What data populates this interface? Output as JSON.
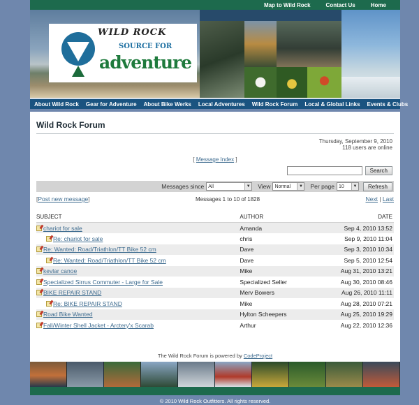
{
  "topnav": [
    "Map to Wild Rock",
    "Contact Us",
    "Home"
  ],
  "logo": {
    "name": "WILD ROCK",
    "tagline_top": "SOURCE FOR",
    "tagline_bottom": "adventure"
  },
  "mainnav": [
    "About Wild Rock",
    "Gear for Adventure",
    "About Bike Werks",
    "Local Adventures",
    "Wild Rock Forum",
    "Local & Global Links",
    "Events & Clubs"
  ],
  "page": {
    "title": "Wild Rock Forum",
    "date": "Thursday, September 9, 2010",
    "users_online": "118 users are online",
    "message_index_pre": "[ ",
    "message_index": "Message Index",
    "message_index_post": " ]"
  },
  "search": {
    "value": "",
    "button": "Search"
  },
  "filters": {
    "since_label": "Messages since",
    "since_value": "All",
    "view_label": "View",
    "view_value": "Normal",
    "perpage_label": "Per page",
    "perpage_value": "10",
    "refresh": "Refresh"
  },
  "pager": {
    "post_new": "Post new message",
    "bracket_open": "[",
    "bracket_close": "]",
    "counts": "Messages 1 to 10 of 1828",
    "next": "Next",
    "sep": " | ",
    "last": "Last"
  },
  "columns": {
    "subject": "SUBJECT",
    "author": "AUTHOR",
    "date": "DATE"
  },
  "messages": [
    {
      "subject": "chariot for sale",
      "author": "Amanda",
      "date": "Sep 4, 2010 13:52",
      "reply": false
    },
    {
      "subject": "Re: chariot for sale",
      "author": "chris",
      "date": "Sep 9, 2010 11:04",
      "reply": true
    },
    {
      "subject": "Re: Wanted: Road/Triathlon/TT Bike 52 cm",
      "author": "Dave",
      "date": "Sep 3, 2010 10:34",
      "reply": false
    },
    {
      "subject": "Re: Wanted: Road/Triathlon/TT Bike 52 cm",
      "author": "Dave",
      "date": "Sep 5, 2010 12:54",
      "reply": true
    },
    {
      "subject": "kevlar canoe",
      "author": "Mike",
      "date": "Aug 31, 2010 13:21",
      "reply": false
    },
    {
      "subject": "Specialized Sirrus Commuter - Large for Sale",
      "author": "Specialized Seller",
      "date": "Aug 30, 2010 08:46",
      "reply": false
    },
    {
      "subject": "BIKE REPAIR STAND",
      "author": "Merv Bowers",
      "date": "Aug 26, 2010 11:11",
      "reply": false
    },
    {
      "subject": "Re: BIKE REPAIR STAND",
      "author": "Mike",
      "date": "Aug 28, 2010 07:21",
      "reply": true
    },
    {
      "subject": "Road Bike Wanted",
      "author": "Hylton Scheepers",
      "date": "Aug 25, 2010 19:29",
      "reply": false
    },
    {
      "subject": "Fall/Winter Shell Jacket - Arctery'x Scarab",
      "author": "Arthur",
      "date": "Aug 22, 2010 12:36",
      "reply": false
    }
  ],
  "powered": {
    "text": "The Wild Rock Forum is powered by ",
    "link": "CodeProject"
  },
  "copyright": "© 2010 Wild Rock Outfitters. All rights reserved.",
  "colors": {
    "topbar": "#1d6a4d",
    "nav": "#1a5380",
    "background": "#6f87ad",
    "link": "#3d6b8f"
  }
}
